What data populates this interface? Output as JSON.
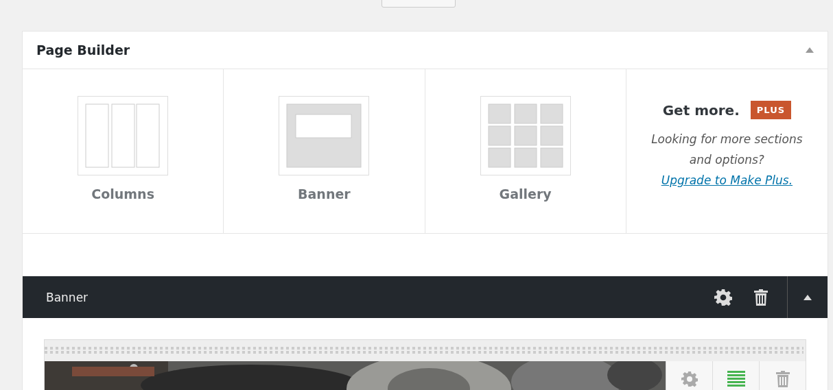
{
  "panel": {
    "title": "Page Builder"
  },
  "sections": [
    {
      "label": "Columns",
      "kind": "columns"
    },
    {
      "label": "Banner",
      "kind": "banner"
    },
    {
      "label": "Gallery",
      "kind": "gallery"
    }
  ],
  "promo": {
    "heading": "Get more.",
    "badge": "PLUS",
    "text": "Looking for more sections and options?",
    "link": "Upgrade to Make Plus."
  },
  "section_bar": {
    "title": "Banner"
  }
}
